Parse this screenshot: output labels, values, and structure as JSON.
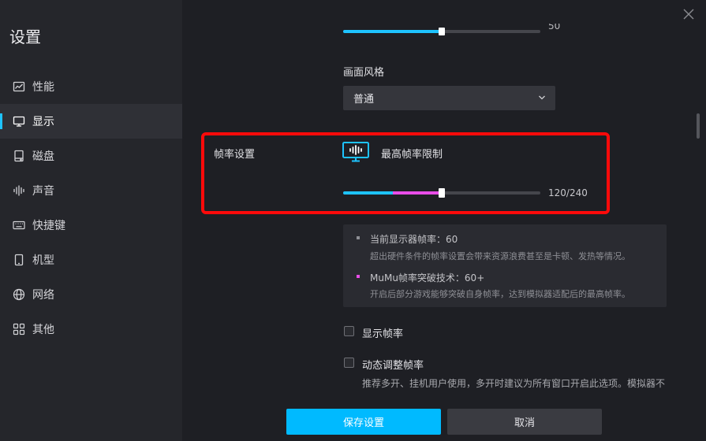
{
  "sidebar": {
    "title": "设置",
    "items": [
      {
        "label": "性能",
        "icon": "chart-icon"
      },
      {
        "label": "显示",
        "icon": "monitor-icon"
      },
      {
        "label": "磁盘",
        "icon": "disk-icon"
      },
      {
        "label": "声音",
        "icon": "sound-icon"
      },
      {
        "label": "快捷键",
        "icon": "keyboard-icon"
      },
      {
        "label": "机型",
        "icon": "phone-icon"
      },
      {
        "label": "网络",
        "icon": "globe-icon"
      },
      {
        "label": "其他",
        "icon": "grid-icon"
      }
    ],
    "active_index": 1
  },
  "top_slider": {
    "value_fraction": 0.5,
    "value_text": "50"
  },
  "style": {
    "label": "画面风格",
    "selected": "普通"
  },
  "framerate": {
    "section_label": "帧率设置",
    "title": "最高帧率限制",
    "value": 120,
    "max": 240,
    "value_text": "120/240",
    "native_fraction": 0.25,
    "info": {
      "item1_title": "当前显示器帧率：60",
      "item1_desc": "超出硬件条件的帧率设置会带来资源浪费甚至是卡顿、发热等情况。",
      "item2_title": "MuMu帧率突破技术：60+",
      "item2_desc": "开启后部分游戏能够突破自身帧率，达到模拟器适配后的最高帧率。"
    }
  },
  "options": {
    "show_fps_label": "显示帧率",
    "dynamic_fps_label": "动态调整帧率",
    "dynamic_fps_desc": "推荐多开、挂机用户使用，多开时建议为所有窗口开启此选项。模拟器不"
  },
  "buttons": {
    "save": "保存设置",
    "cancel": "取消"
  },
  "colors": {
    "accent": "#00baff",
    "slider_pink": "#e94de8",
    "highlight": "#ff0a0a",
    "bullet_gray": "#8e8f95"
  }
}
